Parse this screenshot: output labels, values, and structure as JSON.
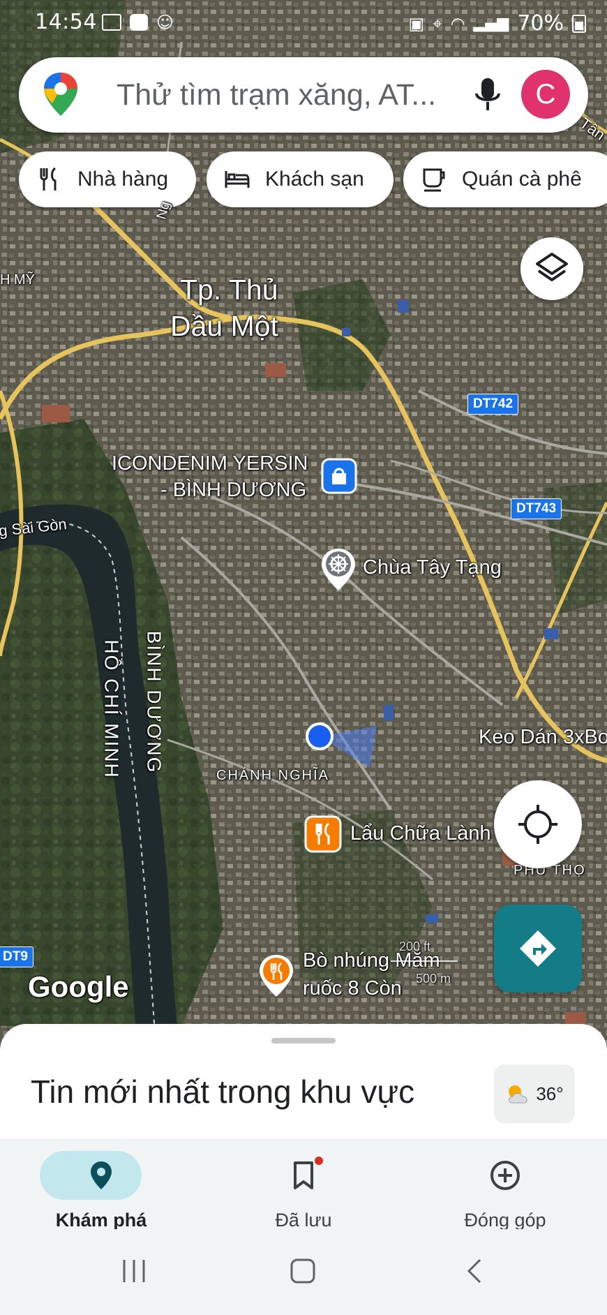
{
  "status_bar": {
    "time": "14:54",
    "battery": "70%"
  },
  "search": {
    "placeholder": "Thử tìm trạm xăng, AT...",
    "avatar_letter": "C"
  },
  "chips": [
    {
      "label": "Nhà hàng",
      "icon": "restaurant-icon"
    },
    {
      "label": "Khách sạn",
      "icon": "hotel-icon"
    },
    {
      "label": "Quán cà phê",
      "icon": "coffee-icon"
    }
  ],
  "map": {
    "city_line1": "Tp. Thủ",
    "city_line2": "Dầu Một",
    "area_hmy": "H MỸ",
    "road_tan": "Tân",
    "road_dt742": "DT742",
    "road_dt743": "DT743",
    "road_dt9": "DT9",
    "river": "g Sài Gòn",
    "province_hcm": "HỒ CHÍ MINH",
    "province_bd": "BÌNH DƯƠNG",
    "poi_icondenim_1": "ICONDENIM YERSIN",
    "poi_icondenim_2": "- BÌNH DƯƠNG",
    "poi_chua": "Chùa Tây Tạng",
    "poi_keo": "Keo Dán 3xBo",
    "district_chanh_nghia": "CHÁNH NGHĨA",
    "poi_lau": "Lẩu Chữa Lành",
    "district_phu_tho": "PHÚ THỌ",
    "poi_bo_1": "Bò nhúng Mắm",
    "poi_bo_2": "ruốc 8 Còn",
    "scale_ft": "200 ft",
    "scale_m": "500 m",
    "google": "Google",
    "road_nguyen": "Ng"
  },
  "sheet": {
    "title": "Tin mới nhất trong khu vực",
    "temperature": "36°"
  },
  "bottom_nav": [
    {
      "label": "Khám phá",
      "active": true
    },
    {
      "label": "Đã lưu",
      "active": false
    },
    {
      "label": "Đóng góp",
      "active": false
    }
  ],
  "colors": {
    "accent_teal": "#137c86",
    "avatar": "#e0336e",
    "active_pill": "#c2e8ee",
    "road_yellow": "#e6c35c"
  }
}
